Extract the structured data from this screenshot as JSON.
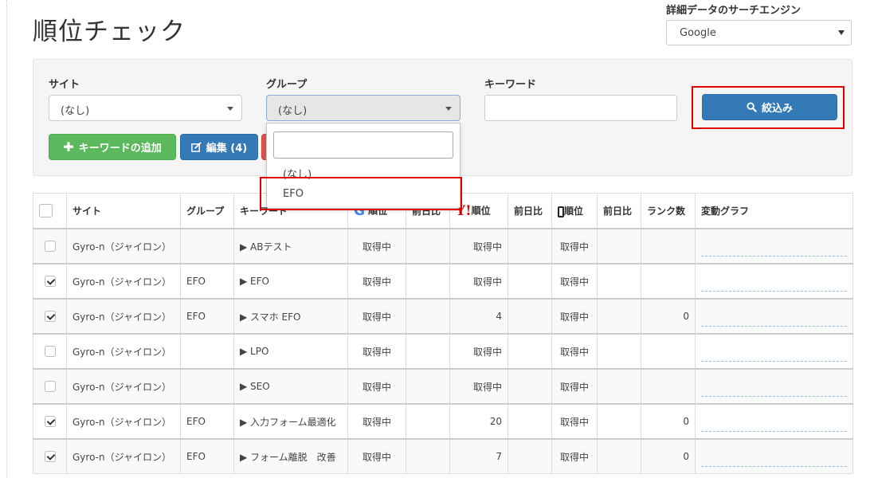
{
  "page": {
    "title": "順位チェック"
  },
  "engine": {
    "label": "詳細データのサーチエンジン",
    "selected": "Google"
  },
  "filters": {
    "site_label": "サイト",
    "site_value": "(なし)",
    "group_label": "グループ",
    "group_value": "(なし)",
    "keyword_label": "キーワード",
    "keyword_value": "",
    "search_button": "絞込み"
  },
  "actions": {
    "add_keyword": "キーワードの追加",
    "edit": "編集 (4)"
  },
  "group_dropdown": {
    "search_value": "",
    "options": [
      "(なし)",
      "EFO"
    ]
  },
  "table": {
    "headers": {
      "site": "サイト",
      "group": "グループ",
      "keyword": "キーワード",
      "google_rank": "順位",
      "google_prev": "前日比",
      "yahoo_rank": "順位",
      "yahoo_prev": "前日比",
      "mobile_rank": "順位",
      "mobile_prev": "前日比",
      "rank_count": "ランク数",
      "graph": "変動グラフ"
    },
    "icons": {
      "google": "G",
      "yahoo": "Y!"
    },
    "rows": [
      {
        "checked": false,
        "site": "Gyro-n（ジャイロン）",
        "group": "",
        "keyword": "▶ ABテスト",
        "g_rank": "取得中",
        "g_prev": "",
        "y_rank": "取得中",
        "y_prev": "",
        "m_rank": "取得中",
        "m_prev": "",
        "rank_count": ""
      },
      {
        "checked": true,
        "site": "Gyro-n（ジャイロン）",
        "group": "EFO",
        "keyword": "▶ EFO",
        "g_rank": "取得中",
        "g_prev": "",
        "y_rank": "取得中",
        "y_prev": "",
        "m_rank": "取得中",
        "m_prev": "",
        "rank_count": ""
      },
      {
        "checked": true,
        "site": "Gyro-n（ジャイロン）",
        "group": "EFO",
        "keyword": "▶ スマホ EFO",
        "g_rank": "取得中",
        "g_prev": "",
        "y_rank": "4",
        "y_prev": "",
        "m_rank": "取得中",
        "m_prev": "",
        "rank_count": "0"
      },
      {
        "checked": false,
        "site": "Gyro-n（ジャイロン）",
        "group": "",
        "keyword": "▶ LPO",
        "g_rank": "取得中",
        "g_prev": "",
        "y_rank": "取得中",
        "y_prev": "",
        "m_rank": "取得中",
        "m_prev": "",
        "rank_count": ""
      },
      {
        "checked": false,
        "site": "Gyro-n（ジャイロン）",
        "group": "",
        "keyword": "▶ SEO",
        "g_rank": "取得中",
        "g_prev": "",
        "y_rank": "取得中",
        "y_prev": "",
        "m_rank": "取得中",
        "m_prev": "",
        "rank_count": ""
      },
      {
        "checked": true,
        "site": "Gyro-n（ジャイロン）",
        "group": "EFO",
        "keyword": "▶ 入力フォーム最適化",
        "g_rank": "取得中",
        "g_prev": "",
        "y_rank": "20",
        "y_prev": "",
        "m_rank": "取得中",
        "m_prev": "",
        "rank_count": "0"
      },
      {
        "checked": true,
        "site": "Gyro-n（ジャイロン）",
        "group": "EFO",
        "keyword": "▶ フォーム離脱　改善",
        "g_rank": "取得中",
        "g_prev": "",
        "y_rank": "7",
        "y_prev": "",
        "m_rank": "取得中",
        "m_prev": "",
        "rank_count": "0"
      }
    ]
  }
}
